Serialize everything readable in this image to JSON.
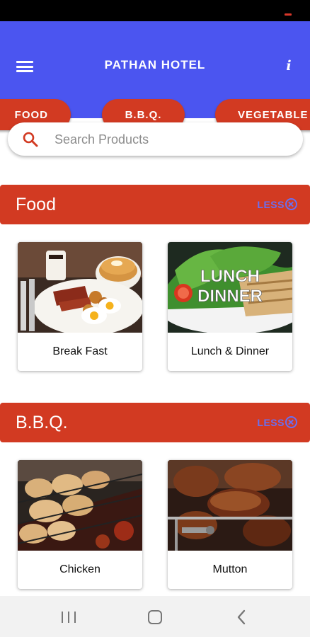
{
  "app": {
    "title": "PATHAN HOTEL"
  },
  "icons": {
    "menu": "hamburger-menu-icon",
    "info": "info-icon",
    "search": "search-icon",
    "less": "close-circle-icon"
  },
  "colors": {
    "app_bar": "#4b55f0",
    "accent_red": "#d23a22",
    "less_text": "#6a6ff0",
    "status_bar": "#000000"
  },
  "chips": [
    {
      "label": "FOOD"
    },
    {
      "label": "B.B.Q."
    },
    {
      "label": "VEGETABLE"
    }
  ],
  "search": {
    "placeholder": "Search Products",
    "value": ""
  },
  "sections": [
    {
      "title": "Food",
      "less_label": "LESS",
      "items": [
        {
          "label": "Break Fast"
        },
        {
          "label": "Lunch & Dinner",
          "image_text_line1": "LUNCH",
          "image_text_line2": "DINNER"
        }
      ]
    },
    {
      "title": "B.B.Q.",
      "less_label": "LESS",
      "items": [
        {
          "label": "Chicken"
        },
        {
          "label": "Mutton"
        }
      ]
    }
  ],
  "nav": {
    "recents": "recents-icon",
    "home": "home-icon",
    "back": "back-icon"
  }
}
